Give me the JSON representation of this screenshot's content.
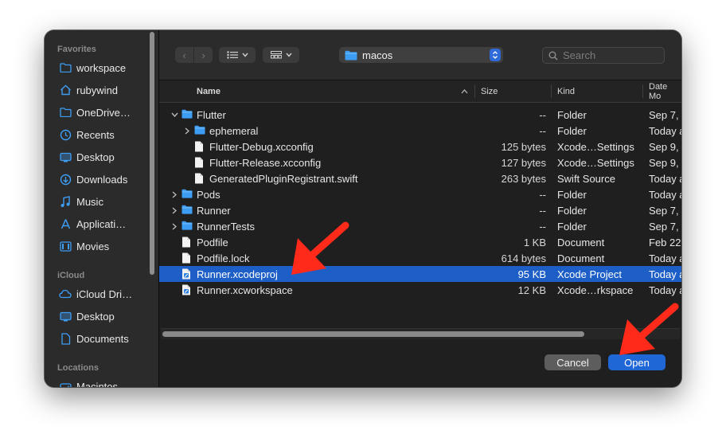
{
  "sidebar": {
    "sections": {
      "favorites": "Favorites",
      "icloud": "iCloud",
      "locations": "Locations"
    },
    "items": [
      {
        "label": "workspace",
        "icon": "folder-icon"
      },
      {
        "label": "rubywind",
        "icon": "home-icon"
      },
      {
        "label": "OneDrive…",
        "icon": "folder-icon"
      },
      {
        "label": "Recents",
        "icon": "clock-icon"
      },
      {
        "label": "Desktop",
        "icon": "desktop-icon"
      },
      {
        "label": "Downloads",
        "icon": "download-icon"
      },
      {
        "label": "Music",
        "icon": "music-icon"
      },
      {
        "label": "Applicati…",
        "icon": "applications-icon"
      },
      {
        "label": "Movies",
        "icon": "movies-icon"
      },
      {
        "label": "iCloud Dri…",
        "icon": "cloud-icon"
      },
      {
        "label": "Desktop",
        "icon": "desktop-icon"
      },
      {
        "label": "Documents",
        "icon": "document-icon"
      },
      {
        "label": "Macintos…",
        "icon": "disk-icon"
      }
    ]
  },
  "toolbar": {
    "back": "‹",
    "forward": "›",
    "location": "macos",
    "search_placeholder": "Search"
  },
  "columns": {
    "name": "Name",
    "size": "Size",
    "kind": "Kind",
    "date": "Date Mo"
  },
  "files": [
    {
      "name": "Flutter",
      "size": "--",
      "kind": "Folder",
      "date": "Sep 7,",
      "type": "folder",
      "expanded": true,
      "level": 0
    },
    {
      "name": "ephemeral",
      "size": "--",
      "kind": "Folder",
      "date": "Today a",
      "type": "folder",
      "expanded": false,
      "level": 1
    },
    {
      "name": "Flutter-Debug.xcconfig",
      "size": "125 bytes",
      "kind": "Xcode…Settings",
      "date": "Sep 9,",
      "type": "file",
      "level": 1
    },
    {
      "name": "Flutter-Release.xcconfig",
      "size": "127 bytes",
      "kind": "Xcode…Settings",
      "date": "Sep 9,",
      "type": "file",
      "level": 1
    },
    {
      "name": "GeneratedPluginRegistrant.swift",
      "size": "263 bytes",
      "kind": "Swift Source",
      "date": "Today a",
      "type": "file",
      "level": 1
    },
    {
      "name": "Pods",
      "size": "--",
      "kind": "Folder",
      "date": "Today a",
      "type": "folder",
      "expanded": false,
      "level": 0
    },
    {
      "name": "Runner",
      "size": "--",
      "kind": "Folder",
      "date": "Sep 7,",
      "type": "folder",
      "expanded": false,
      "level": 0
    },
    {
      "name": "RunnerTests",
      "size": "--",
      "kind": "Folder",
      "date": "Sep 7,",
      "type": "folder",
      "expanded": false,
      "level": 0
    },
    {
      "name": "Podfile",
      "size": "1 KB",
      "kind": "Document",
      "date": "Feb 22",
      "type": "file",
      "level": 0
    },
    {
      "name": "Podfile.lock",
      "size": "614 bytes",
      "kind": "Document",
      "date": "Today a",
      "type": "file",
      "level": 0
    },
    {
      "name": "Runner.xcodeproj",
      "size": "95 KB",
      "kind": "Xcode Project",
      "date": "Today a",
      "type": "xcode",
      "level": 0,
      "selected": true
    },
    {
      "name": "Runner.xcworkspace",
      "size": "12 KB",
      "kind": "Xcode…rkspace",
      "date": "Today a",
      "type": "xcode",
      "level": 0
    }
  ],
  "buttons": {
    "cancel": "Cancel",
    "open": "Open"
  },
  "colors": {
    "accent": "#1f66d6",
    "selection": "#1e5fc7",
    "folder": "#3d9df3",
    "arrow": "#ff2a1a"
  }
}
